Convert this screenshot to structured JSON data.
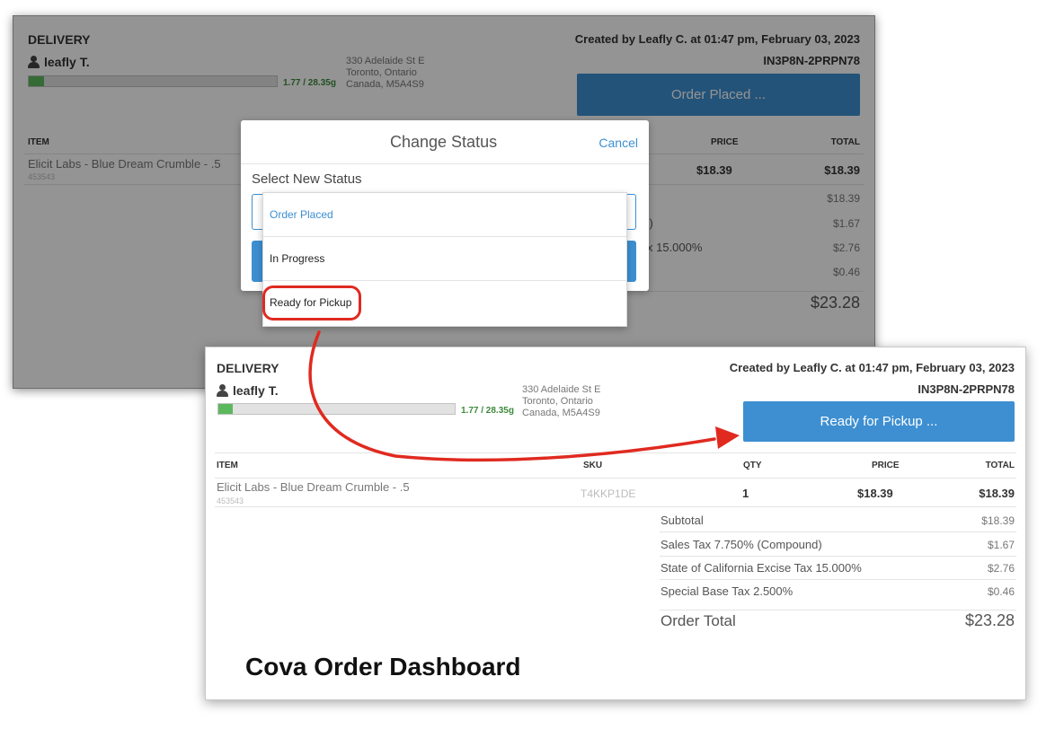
{
  "order": {
    "type_label": "DELIVERY",
    "customer": "leafly T.",
    "weight_text": "1.77 / 28.35g",
    "weight_fraction": 0.0624,
    "address": [
      "330 Adelaide St E",
      "Toronto, Ontario",
      "Canada, M5A4S9"
    ],
    "created_by": "Created by Leafly C. at 01:47 pm, February 03, 2023",
    "order_id": "IN3P8N-2PRPN78"
  },
  "table": {
    "headers": {
      "item": "ITEM",
      "sku": "SKU",
      "qty": "QTY",
      "price": "PRICE",
      "total": "TOTAL"
    },
    "rows": [
      {
        "name": "Elicit Labs - Blue Dream Crumble - .5",
        "code": "453543",
        "sku": "T4KKP1DE",
        "qty": "1",
        "price": "$18.39",
        "total": "$18.39"
      }
    ]
  },
  "totals": {
    "subtotal_label": "Subtotal",
    "subtotal": "$18.39",
    "sales_tax_label": "Sales Tax  7.750% (Compound)",
    "sales_tax": "$1.67",
    "excise_label": "State of California Excise Tax  15.000%",
    "excise": "$2.76",
    "special_label": "Special Base Tax  2.500%",
    "special": "$0.46",
    "grand_label": "Order Total",
    "grand": "$23.28"
  },
  "background_view": {
    "status_button": "Order Placed ...",
    "sales_tax_fragment": "nd)",
    "excise_fragment": "x  15.000%"
  },
  "front_view": {
    "status_button": "Ready for Pickup ..."
  },
  "modal": {
    "title": "Change Status",
    "cancel": "Cancel",
    "subtitle": "Select New Status",
    "options": [
      "Order Placed",
      "In Progress",
      "Ready for Pickup"
    ]
  },
  "caption": "Cova Order Dashboard",
  "colors": {
    "accent": "#3d8fd1",
    "progress": "#5cb85c",
    "annotation": "#e02a20"
  }
}
